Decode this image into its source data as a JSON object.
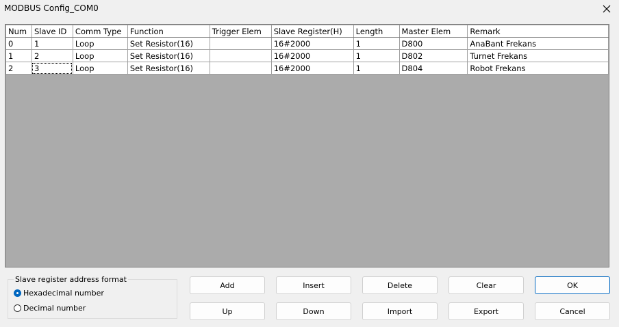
{
  "window": {
    "title": "MODBUS Config_COM0"
  },
  "table": {
    "columns": [
      "Num",
      "Slave ID",
      "Comm Type",
      "Function",
      "Trigger Elem",
      "Slave Register(H)",
      "Length",
      "Master Elem",
      "Remark"
    ],
    "rows": [
      [
        "0",
        "1",
        "Loop",
        "Set Resistor(16)",
        "",
        "16#2000",
        "1",
        "D800",
        "AnaBant Frekans"
      ],
      [
        "1",
        "2",
        "Loop",
        "Set Resistor(16)",
        "",
        "16#2000",
        "1",
        "D802",
        "Turnet Frekans"
      ],
      [
        "2",
        "3",
        "Loop",
        "Set Resistor(16)",
        "",
        "16#2000",
        "1",
        "D804",
        "Robot Frekans"
      ]
    ]
  },
  "address_format": {
    "title": "Slave register address format",
    "options": [
      {
        "label": "Hexadecimal number",
        "checked": true
      },
      {
        "label": "Decimal number",
        "checked": false
      }
    ]
  },
  "buttons": {
    "add": "Add",
    "insert": "Insert",
    "delete": "Delete",
    "clear": "Clear",
    "ok": "OK",
    "up": "Up",
    "down": "Down",
    "import": "Import",
    "export": "Export",
    "cancel": "Cancel"
  }
}
